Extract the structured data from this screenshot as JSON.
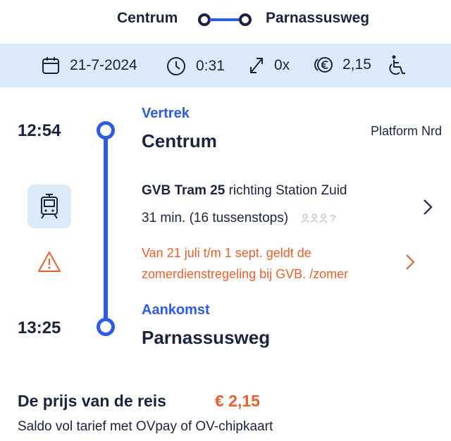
{
  "route": {
    "from": "Centrum",
    "to": "Parnassusweg"
  },
  "info_bar": {
    "date": "21-7-2024",
    "duration": "0:31",
    "transfers": "0x",
    "price": "2,15",
    "icons": [
      "calendar-icon",
      "clock-icon",
      "transfers-icon",
      "euro-coins-icon",
      "wheelchair-icon"
    ]
  },
  "departure": {
    "time": "12:54",
    "label": "Vertrek",
    "station": "Centrum",
    "platform": "Platform Nrd"
  },
  "leg": {
    "operator_line": "GVB Tram 25",
    "direction": "richting Station Zuid",
    "duration_stops": "31 min. (16 tussenstops)",
    "crowd_unknown": "?",
    "notice": "Van 21 juli t/m 1 sept. geldt de zomerdienstregeling bij GVB. /zomer"
  },
  "arrival": {
    "time": "13:25",
    "label": "Aankomst",
    "station": "Parnassusweg"
  },
  "price": {
    "title": "De prijs van de reis",
    "value": "€ 2,15",
    "subtitle": "Saldo vol tarief met OVpay of OV-chipkaart"
  },
  "colors": {
    "brand_blue": "#2d5be3",
    "dark_navy": "#1c2340",
    "warning_orange": "#e8612c",
    "info_bar_bg": "#dbeaf8"
  }
}
